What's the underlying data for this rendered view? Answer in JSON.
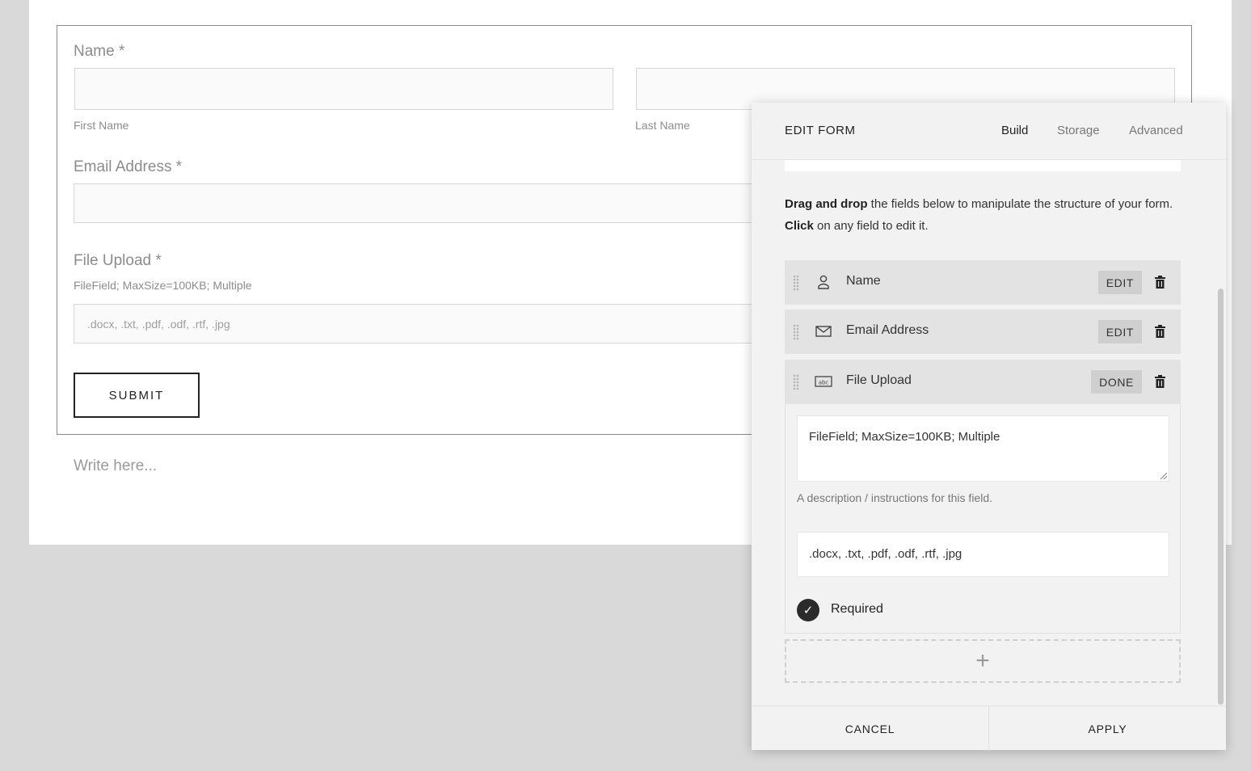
{
  "form": {
    "name_label": "Name *",
    "first_name_sub": "First Name",
    "last_name_sub": "Last Name",
    "email_label": "Email Address *",
    "file_label": "File Upload *",
    "file_desc": "FileField; MaxSize=100KB; Multiple",
    "file_placeholder": ".docx, .txt, .pdf, .odf, .rtf, .jpg",
    "submit_label": "SUBMIT",
    "write_here": "Write here..."
  },
  "panel": {
    "title": "EDIT FORM",
    "tabs": [
      {
        "label": "Build",
        "active": true
      },
      {
        "label": "Storage",
        "active": false
      },
      {
        "label": "Advanced",
        "active": false
      }
    ],
    "intro_bold1": "Drag and drop",
    "intro_text1": " the fields below to manipulate the structure of your form. ",
    "intro_bold2": "Click",
    "intro_text2": " on any field to edit it.",
    "fields": [
      {
        "label": "Name",
        "icon": "person-icon",
        "button": "EDIT"
      },
      {
        "label": "Email Address",
        "icon": "envelope-icon",
        "button": "EDIT"
      },
      {
        "label": "File Upload",
        "icon": "text-field-icon",
        "button": "DONE"
      }
    ],
    "editor": {
      "description_value": "FileField; MaxSize=100KB; Multiple",
      "description_help": "A description / instructions for this field.",
      "extensions_value": ".docx, .txt, .pdf, .odf, .rtf, .jpg",
      "required_label": "Required",
      "required_checked": true
    },
    "add_symbol": "+",
    "cancel_label": "CANCEL",
    "apply_label": "APPLY"
  }
}
